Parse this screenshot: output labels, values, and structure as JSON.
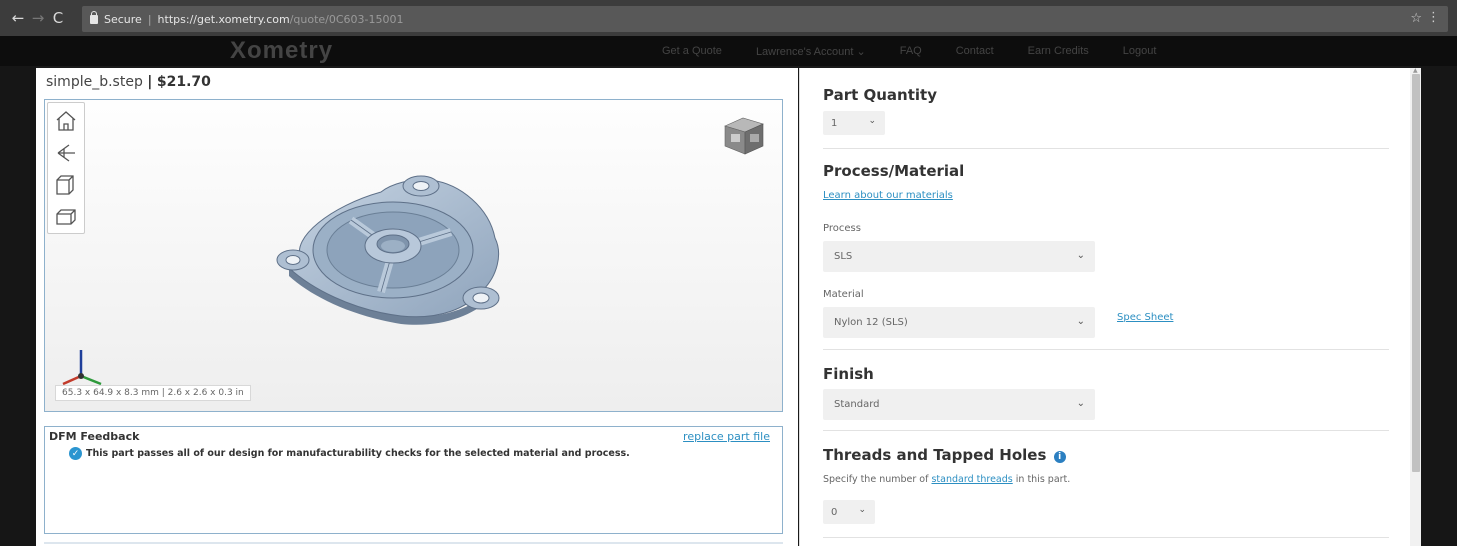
{
  "browser": {
    "secure_label": "Secure",
    "url_host": "https://get.xometry.com",
    "url_path": "/quote/0C603-15001"
  },
  "site": {
    "logo": "Xometry",
    "nav": [
      "Get a Quote",
      "Lawrence's Account",
      "FAQ",
      "Contact",
      "Earn Credits",
      "Logout"
    ]
  },
  "part": {
    "filename": "simple_b.step",
    "separator": "|",
    "price": "$21.70",
    "dimensions": "65.3 x 64.9 x 8.3 mm  |  2.6 x 2.6 x 0.3 in"
  },
  "viewer_tools": [
    "home-view-icon",
    "look-at-icon",
    "front-view-icon",
    "iso-view-icon"
  ],
  "dfm": {
    "title": "DFM Feedback",
    "replace_link": "replace part file",
    "message": "This part passes all of our design for manufacturability checks for the selected material and process."
  },
  "config": {
    "quantity": {
      "heading": "Part Quantity",
      "value": "1"
    },
    "process_material": {
      "heading": "Process/Material",
      "learn_link": "Learn about our materials",
      "process_label": "Process",
      "process_value": "SLS",
      "material_label": "Material",
      "material_value": "Nylon 12 (SLS)",
      "spec_link": "Spec Sheet"
    },
    "finish": {
      "heading": "Finish",
      "value": "Standard"
    },
    "threads": {
      "heading": "Threads and Tapped Holes",
      "help_prefix": "Specify the number of",
      "help_link": "standard threads",
      "help_suffix": "in this part.",
      "value": "0"
    }
  },
  "colors": {
    "accent_link": "#2c8fc2",
    "check_blue": "#2b95d0",
    "viewer_border": "#8eb1cc",
    "part_steel": "#9fb2c8"
  }
}
